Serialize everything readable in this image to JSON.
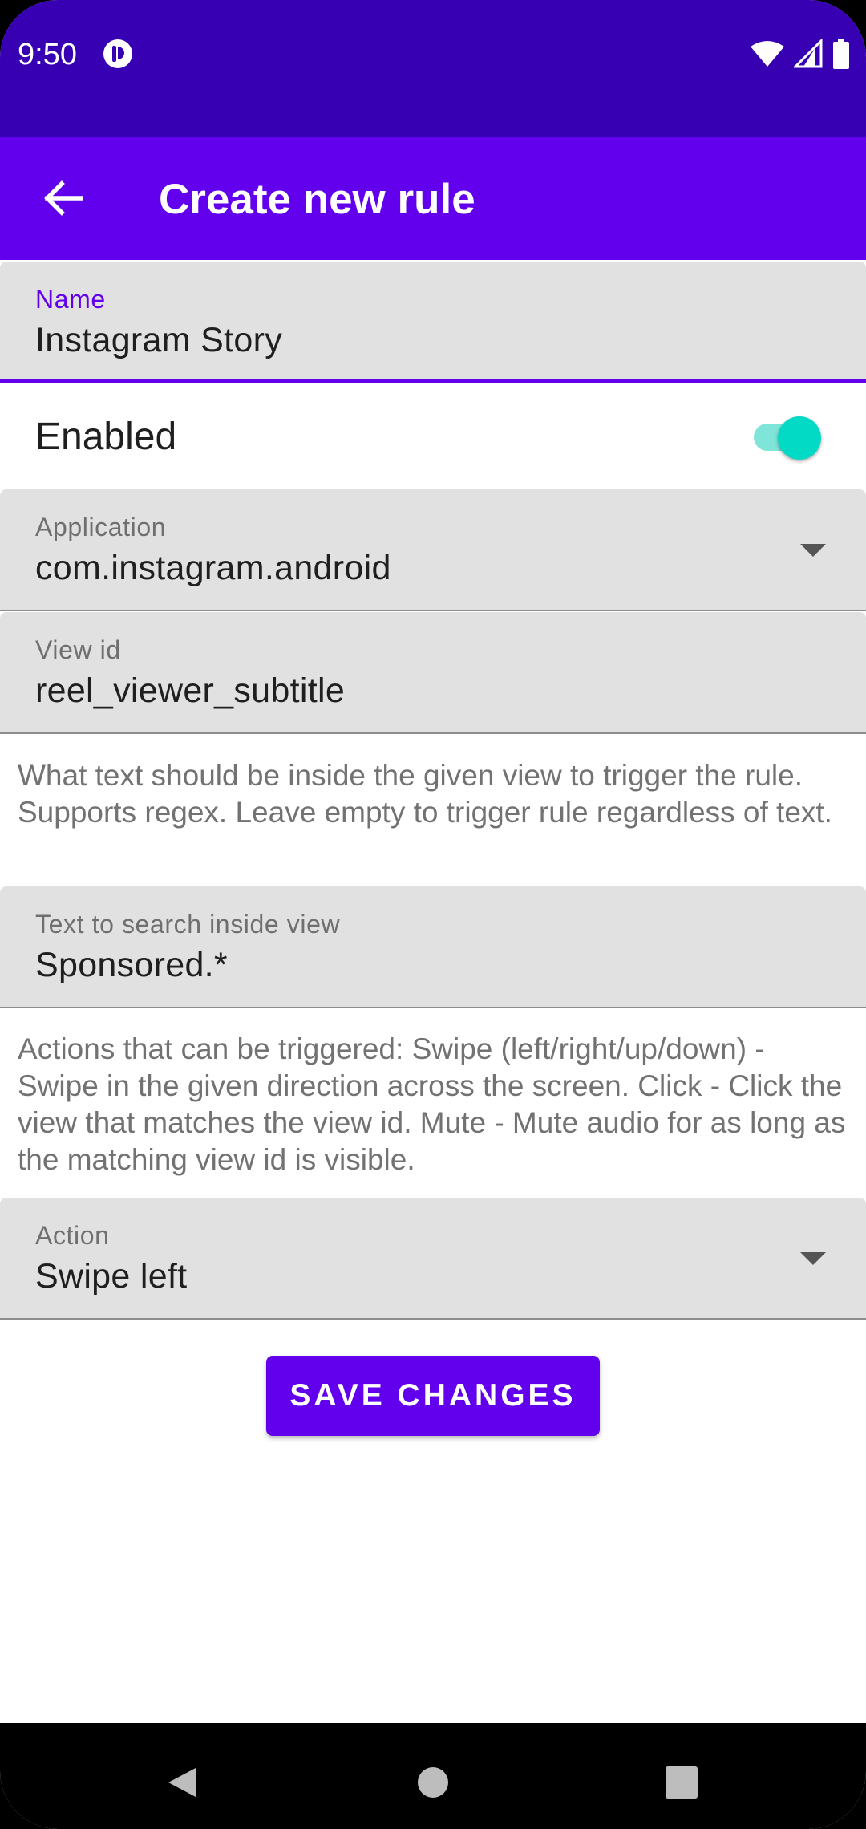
{
  "status_bar": {
    "time": "9:50",
    "icons": [
      "app-notification-icon",
      "wifi-icon",
      "cell-signal-icon",
      "battery-icon"
    ]
  },
  "app_bar": {
    "title": "Create new rule",
    "back_icon": "arrow-back-icon"
  },
  "form": {
    "name": {
      "label": "Name",
      "value": "Instagram Story"
    },
    "enabled": {
      "label": "Enabled",
      "checked": true
    },
    "application": {
      "label": "Application",
      "value": "com.instagram.android"
    },
    "view_id": {
      "label": "View id",
      "value": "reel_viewer_subtitle"
    },
    "text_helper": "What text should be inside the given view to trigger the rule. Supports regex. Leave empty to trigger rule regardless of text.",
    "text_search": {
      "label": "Text to search inside view",
      "value": "Sponsored.*"
    },
    "actions_helper": "Actions that can be triggered: Swipe (left/right/up/down) - Swipe in the given direction across the screen. Click - Click the view that matches the view id. Mute - Mute audio for as long as the matching view id is visible.",
    "action": {
      "label": "Action",
      "value": "Swipe left"
    },
    "save_label": "SAVE CHANGES"
  },
  "nav_bar": {
    "icons": [
      "back-triangle-icon",
      "home-circle-icon",
      "recents-square-icon"
    ]
  },
  "colors": {
    "status_bar": "#3700b3",
    "primary": "#6200ee",
    "switch_accent": "#03dac5",
    "field_background": "#e1e1e1"
  }
}
